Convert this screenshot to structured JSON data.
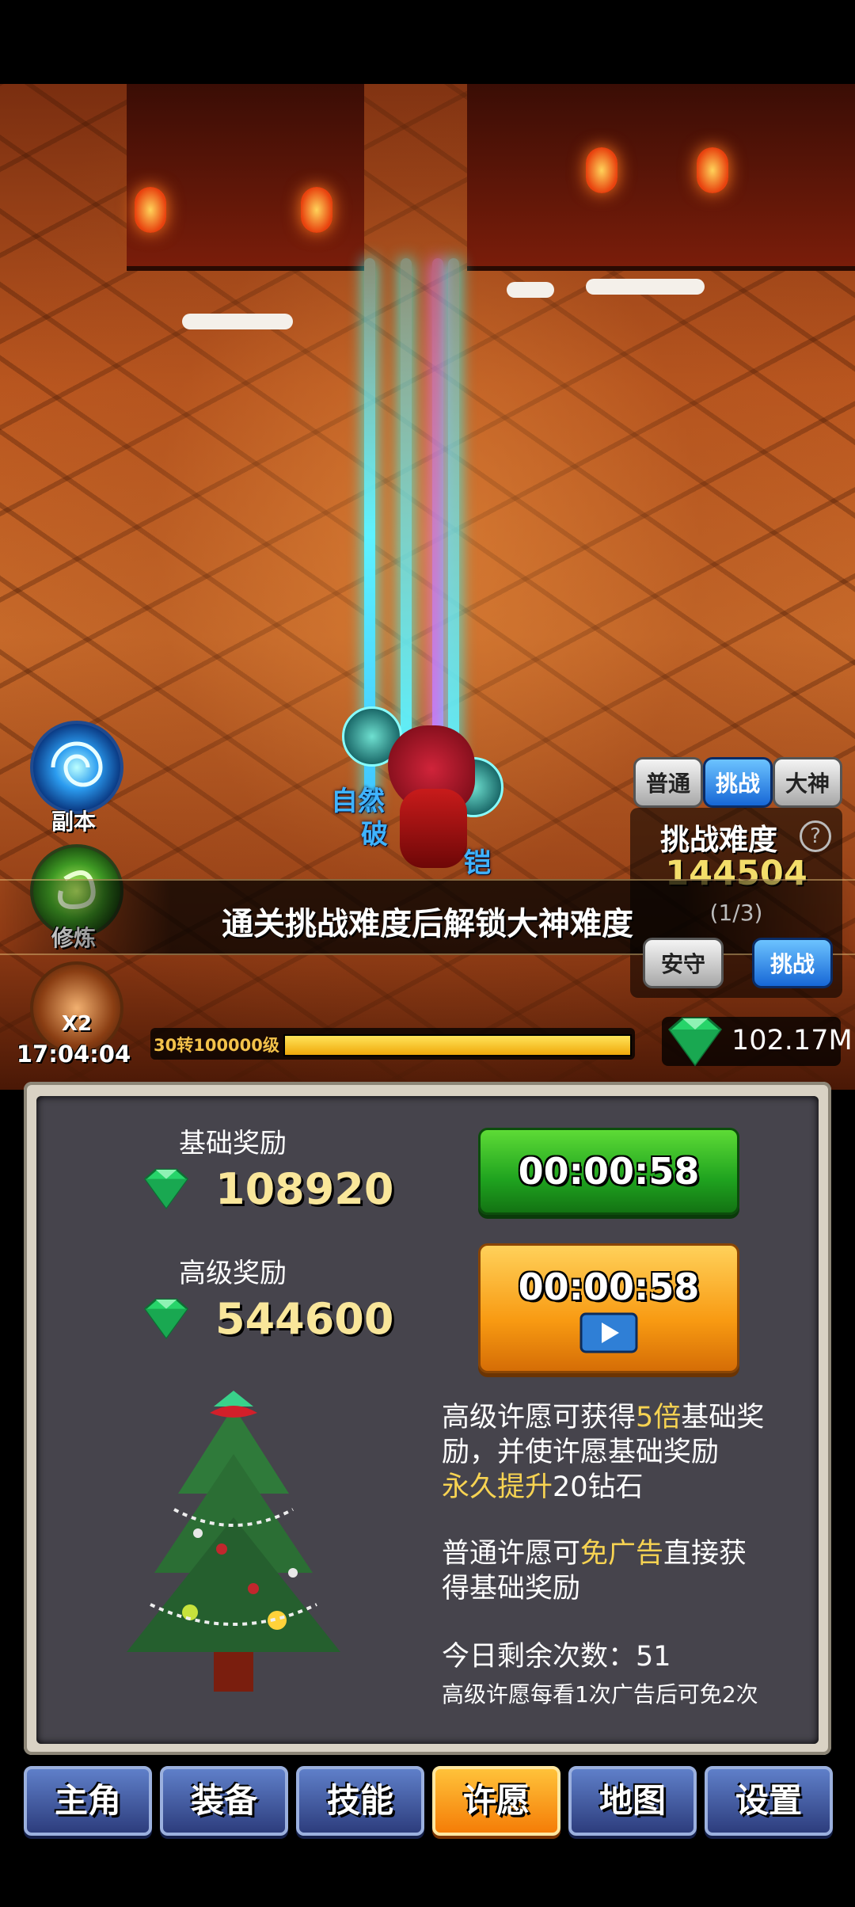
{
  "scene": {
    "float_texts": [
      "自然",
      "破",
      "铠"
    ]
  },
  "side_buttons": {
    "dungeon": {
      "label": "副本",
      "icon": "vortex-icon"
    },
    "cultivate": {
      "label": "修炼",
      "icon": "swirl-icon"
    },
    "boost": {
      "icon": "pot-x2-icon",
      "badge": "X2",
      "timer": "17:04:04"
    }
  },
  "difficulty": {
    "tabs": [
      {
        "label": "普通",
        "selected": false
      },
      {
        "label": "挑战",
        "selected": true
      },
      {
        "label": "大神",
        "selected": false
      }
    ],
    "title": "挑战难度",
    "help_icon": "question-icon",
    "value": "144504",
    "progress": "(1/3)",
    "safe_label": "安守",
    "challenge_label": "挑战"
  },
  "banner": {
    "text": "通关挑战难度后解锁大神难度"
  },
  "level": {
    "label": "30转100000级",
    "progress": 1.0
  },
  "currency": {
    "icon": "green-gem-icon",
    "amount": "102.17M"
  },
  "reward": {
    "basic_label": "基础奖励",
    "basic_value": "108920",
    "advanced_label": "高级奖励",
    "advanced_value": "544600",
    "basic_timer": "00:00:58",
    "advanced_timer": "00:00:58",
    "video_icon": "play-video-icon",
    "tree_icon": "christmas-tree-icon",
    "desc1": {
      "a": "高级许愿可获得",
      "b": "5倍",
      "c": "基础",
      "d": "奖励，并使许愿基础奖励",
      "e": "永久提升",
      "f": "20钻石"
    },
    "desc2": {
      "a": "普通许愿可",
      "b": "免广告",
      "c": "直接获",
      "d": "得基础奖励"
    },
    "remaining": "今日剩余次数：51",
    "note": "高级许愿每看1次广告后可免2次"
  },
  "nav": [
    {
      "label": "主角",
      "selected": false
    },
    {
      "label": "装备",
      "selected": false
    },
    {
      "label": "技能",
      "selected": false
    },
    {
      "label": "许愿",
      "selected": true
    },
    {
      "label": "地图",
      "selected": false
    },
    {
      "label": "设置",
      "selected": false
    }
  ],
  "colors": {
    "accent_gold": "#f7d352",
    "green_button": "#1fa31f",
    "orange_button": "#f89a12",
    "nav_blue": "#3a4f9a"
  }
}
